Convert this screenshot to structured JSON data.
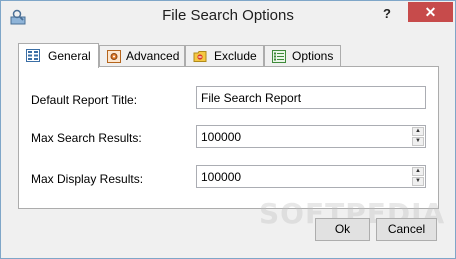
{
  "window": {
    "title": "File Search Options",
    "help_label": "?",
    "close_label": "✕"
  },
  "tabs": [
    {
      "label": "General",
      "icon": "general-grid-icon",
      "active": true
    },
    {
      "label": "Advanced",
      "icon": "advanced-gear-icon",
      "active": false
    },
    {
      "label": "Exclude",
      "icon": "exclude-folder-icon",
      "active": false
    },
    {
      "label": "Options",
      "icon": "options-list-icon",
      "active": false
    }
  ],
  "general": {
    "report_title_label": "Default Report Title:",
    "report_title_value": "File Search Report",
    "max_search_label": "Max Search Results:",
    "max_search_value": "100000",
    "max_display_label": "Max Display Results:",
    "max_display_value": "100000"
  },
  "buttons": {
    "ok_label": "Ok",
    "cancel_label": "Cancel"
  },
  "colors": {
    "close_button": "#c74b4b",
    "window_border": "#7fa6c8",
    "panel_bg": "#ffffff",
    "dialog_bg": "#f0f0f0"
  },
  "watermark": "SOFTPEDIA"
}
